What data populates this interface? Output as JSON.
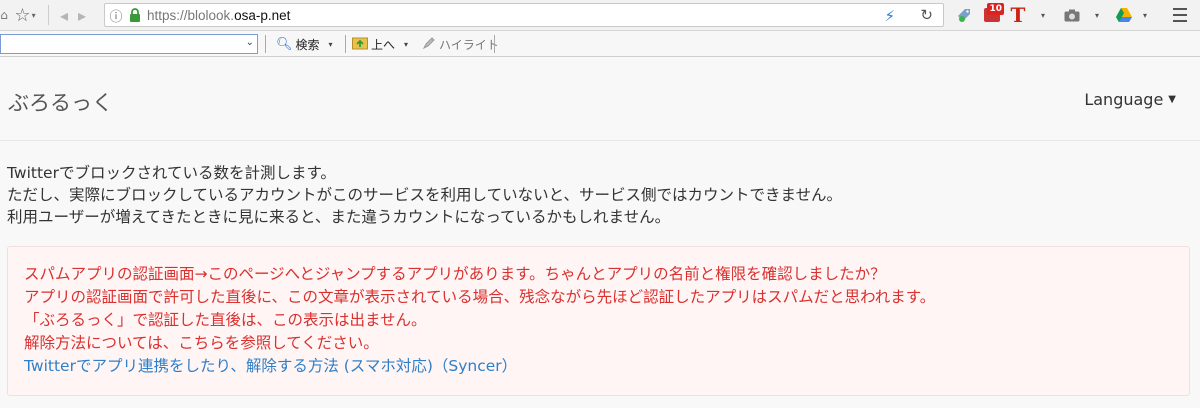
{
  "browser": {
    "url_host_prefix": "https://blolook.",
    "url_host_domain": "osa-p.net",
    "ext_badge_count": "10",
    "ext_t_letter": "T"
  },
  "toolbar": {
    "search_label": "検索",
    "up_label": "上へ",
    "highlight_label": "ハイライト"
  },
  "site": {
    "brand": "ぶろるっく",
    "language_label": "Language"
  },
  "intro": {
    "lines": [
      "Twitterでブロックされている数を計測します。",
      "ただし、実際にブロックしているアカウントがこのサービスを利用していないと、サービス側ではカウントできません。",
      "利用ユーザーが増えてきたときに見に来ると、また違うカウントになっているかもしれません。"
    ]
  },
  "alert": {
    "lines": [
      "スパムアプリの認証画面→このページへとジャンプするアプリがあります。ちゃんとアプリの名前と権限を確認しましたか？",
      "アプリの認証画面で許可した直後に、この文章が表示されている場合、残念ながら先ほど認証したアプリはスパムだと思われます。",
      "「ぶろるっく」で認証した直後は、この表示は出ません。",
      "解除方法については、こちらを参照してください。"
    ],
    "link_text": "Twitterでアプリ連携をしたり、解除する方法 (スマホ対応)（Syncer）"
  },
  "colors": {
    "alert_text": "#d9312f",
    "alert_bg": "#fff5f5",
    "link": "#2f7fc8"
  }
}
